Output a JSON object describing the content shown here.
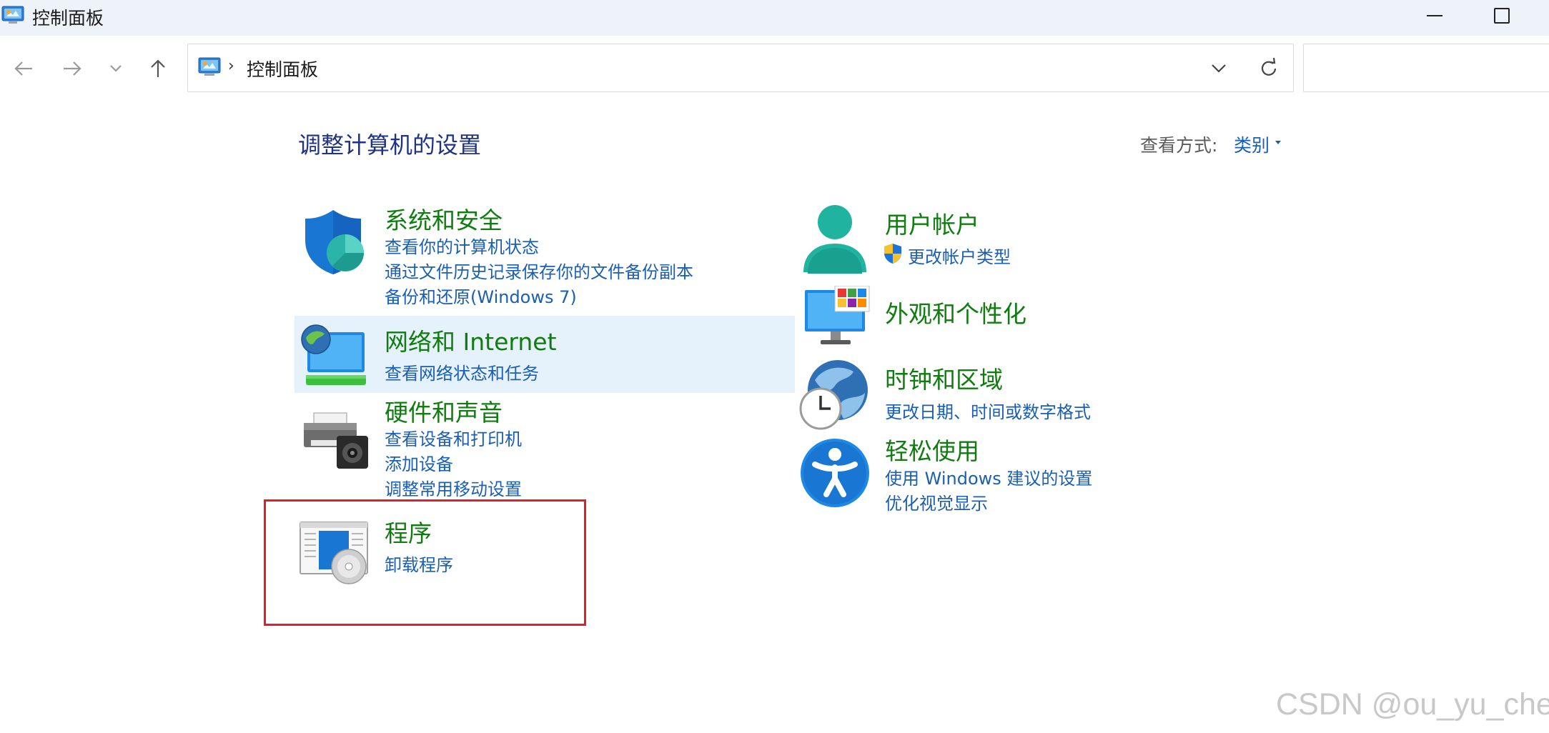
{
  "window": {
    "title": "控制面板"
  },
  "address": {
    "crumb": "控制面板",
    "separator": "›"
  },
  "search": {
    "placeholder": ""
  },
  "main": {
    "heading": "调整计算机的设置",
    "view_by_label": "查看方式:",
    "view_by_value": "类别"
  },
  "categories": {
    "system_security": {
      "title": "系统和安全",
      "links": [
        "查看你的计算机状态",
        "通过文件历史记录保存你的文件备份副本",
        "备份和还原(Windows 7)"
      ]
    },
    "network": {
      "title": "网络和 Internet",
      "links": [
        "查看网络状态和任务"
      ]
    },
    "hardware": {
      "title": "硬件和声音",
      "links": [
        "查看设备和打印机",
        "添加设备",
        "调整常用移动设置"
      ]
    },
    "programs": {
      "title": "程序",
      "links": [
        "卸载程序"
      ]
    },
    "user_accounts": {
      "title": "用户帐户",
      "links": [
        "更改帐户类型"
      ]
    },
    "appearance": {
      "title": "外观和个性化",
      "links": []
    },
    "clock_region": {
      "title": "时钟和区域",
      "links": [
        "更改日期、时间或数字格式"
      ]
    },
    "ease_of_access": {
      "title": "轻松使用",
      "links": [
        "使用 Windows 建议的设置",
        "优化视觉显示"
      ]
    }
  },
  "watermark": "CSDN @ou_yu_chen",
  "colors": {
    "category_title": "#107c10",
    "link": "#1a5fb4",
    "heading": "#1e3287",
    "highlight_box": "#e0202a",
    "hover_bg": "#e5f1fb"
  },
  "icons": [
    "control-panel-icon",
    "back-arrow-icon",
    "forward-arrow-icon",
    "recent-dropdown-icon",
    "up-arrow-icon",
    "address-dropdown-icon",
    "refresh-icon",
    "shield-icon",
    "network-icon",
    "printer-speaker-icon",
    "programs-disc-icon",
    "user-icon",
    "uac-shield-icon",
    "monitor-palette-icon",
    "globe-clock-icon",
    "accessibility-icon"
  ]
}
